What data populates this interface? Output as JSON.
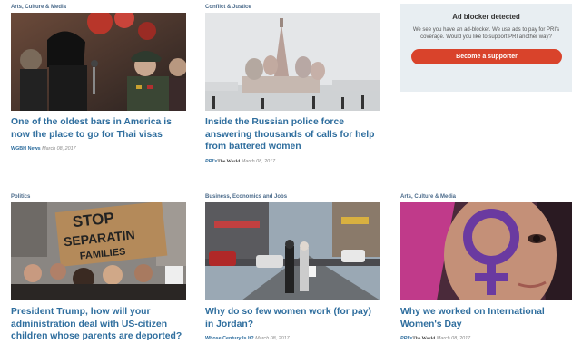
{
  "cards": [
    {
      "category": "Arts, Culture & Media",
      "title": "One of the oldest bars in America is now the place to go for Thai visas",
      "source": "WGBH News",
      "date": "March 08, 2017"
    },
    {
      "category": "Conflict & Justice",
      "title": "Inside the Russian police force answering thousands of calls for help from battered women",
      "source_prefix": "PRI's",
      "source_brand": "The World",
      "date": "March 08, 2017"
    },
    {
      "category": "Politics",
      "title": "President Trump, how will your administration deal with US-citizen children whose parents are deported?",
      "sign_text": [
        "STOP",
        "SEPARATIN",
        "FAMILIES"
      ]
    },
    {
      "category": "Business, Economics and Jobs",
      "title": "Why do so few women work (for pay) in Jordan?",
      "source": "Whose Century Is It?",
      "date": "March 08, 2017"
    },
    {
      "category": "Arts, Culture & Media",
      "title": "Why we worked on International Women's Day",
      "source_prefix": "PRI's",
      "source_brand": "The World",
      "date": "March 08, 2017"
    }
  ],
  "ad": {
    "heading": "Ad blocker detected",
    "message": "We see you have an ad-blocker. We use ads to pay for PRI's coverage. Would you like to support PRI another way?",
    "button_label": "Become a supporter"
  }
}
